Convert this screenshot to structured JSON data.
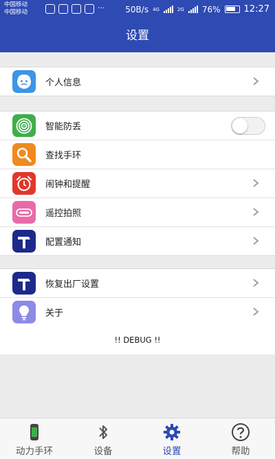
{
  "status_bar": {
    "carrier_1": "中国移动",
    "carrier_2": "中国移动",
    "more": "···",
    "speed": "50B/s",
    "net_1": "4G",
    "net_2": "2G",
    "battery": "76%",
    "time": "12:27"
  },
  "title": "设置",
  "groups": [
    {
      "items": [
        {
          "label": "个人信息",
          "icon": "profile-face-icon",
          "accessory": "chevron"
        }
      ]
    },
    {
      "items": [
        {
          "label": "智能防丢",
          "icon": "target-icon",
          "accessory": "switch",
          "switch_on": false
        },
        {
          "label": "查找手环",
          "icon": "magnifier-icon",
          "accessory": "none"
        },
        {
          "label": "闹钟和提醒",
          "icon": "alarm-clock-icon",
          "accessory": "chevron"
        },
        {
          "label": "遥控拍照",
          "icon": "camera-remote-icon",
          "accessory": "chevron"
        },
        {
          "label": "配置通知",
          "icon": "hammer-icon",
          "accessory": "chevron"
        }
      ]
    },
    {
      "items": [
        {
          "label": "恢复出厂设置",
          "icon": "hammer-icon",
          "accessory": "chevron"
        },
        {
          "label": "关于",
          "icon": "lightbulb-icon",
          "accessory": "chevron"
        }
      ]
    }
  ],
  "debug_label": "!! DEBUG !!",
  "tabs": [
    {
      "label": "动力手环",
      "icon": "band-icon",
      "active": false
    },
    {
      "label": "设备",
      "icon": "bluetooth-icon",
      "active": false
    },
    {
      "label": "设置",
      "icon": "gear-icon",
      "active": true
    },
    {
      "label": "帮助",
      "icon": "help-icon",
      "active": false
    }
  ],
  "colors": {
    "brand": "#2e4ab3",
    "icon_profile": "#3c95e6",
    "icon_target": "#3fae49",
    "icon_search": "#f08a1e",
    "icon_alarm": "#e2372b",
    "icon_camera": "#e86aa9",
    "icon_hammer": "#1d2a8c",
    "icon_bulb": "#8e8ae8"
  }
}
